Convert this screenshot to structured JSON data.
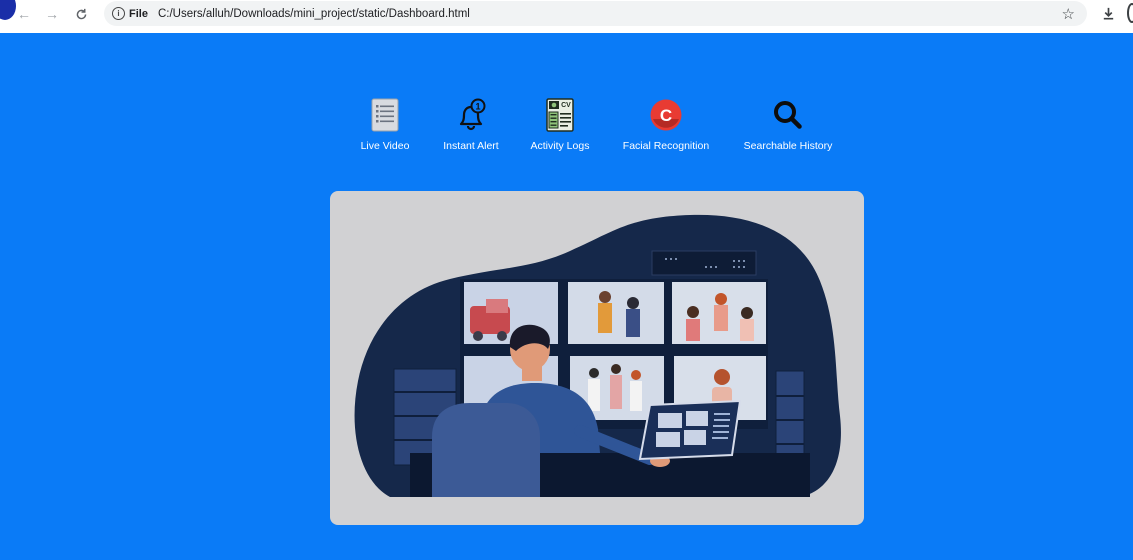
{
  "browser": {
    "site_label": "File",
    "url": "C:/Users/alluh/Downloads/mini_project/static/Dashboard.html",
    "icons": [
      "back-arrow-icon",
      "forward-arrow-icon",
      "reload-icon",
      "info-icon",
      "star-icon",
      "download-icon"
    ]
  },
  "features": [
    {
      "label": "Live Video",
      "icon": "list-document-icon"
    },
    {
      "label": "Instant Alert",
      "icon": "bell-notification-icon"
    },
    {
      "label": "Activity Logs",
      "icon": "cv-document-icon"
    },
    {
      "label": "Facial Recognition",
      "icon": "red-c-logo-icon"
    },
    {
      "label": "Searchable History",
      "icon": "search-magnifier-icon"
    }
  ],
  "colors": {
    "page_bg": "#0a7bf7",
    "card_bg": "#d1d1d3",
    "illustration_dark": "#15284a",
    "accent_blue": "#2f5597"
  }
}
